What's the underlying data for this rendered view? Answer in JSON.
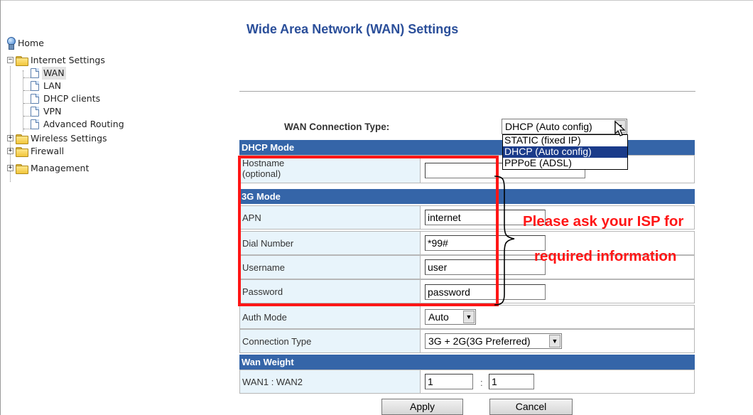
{
  "nav": {
    "items": [
      {
        "label": "Home"
      },
      {
        "label": "Internet Settings"
      },
      {
        "label": "WAN"
      },
      {
        "label": "LAN"
      },
      {
        "label": "DHCP clients"
      },
      {
        "label": "VPN"
      },
      {
        "label": "Advanced Routing"
      },
      {
        "label": "Wireless Settings"
      },
      {
        "label": "Firewall"
      },
      {
        "label": "Management"
      }
    ],
    "selected": "WAN"
  },
  "page": {
    "title": "Wide Area Network (WAN) Settings"
  },
  "wan_connection": {
    "label": "WAN Connection Type:",
    "selected": "DHCP (Auto config)",
    "options": [
      "STATIC (fixed IP)",
      "DHCP (Auto config)",
      "PPPoE (ADSL)"
    ],
    "highlighted": "DHCP (Auto config)"
  },
  "dhcp_mode": {
    "header": "DHCP Mode",
    "hostname_label_line1": "Hostname",
    "hostname_label_line2": "(optional)",
    "hostname_value": ""
  },
  "mode_3g": {
    "header": "3G Mode",
    "apn_label": "APN",
    "apn_value": "internet",
    "dial_label": "Dial Number",
    "dial_value": "*99#",
    "username_label": "Username",
    "username_value": "user",
    "password_label": "Password",
    "password_value": "password",
    "auth_label": "Auth Mode",
    "auth_value": "Auto",
    "conn_type_label": "Connection Type",
    "conn_type_value": "3G + 2G(3G Preferred)"
  },
  "wan_weight": {
    "header": "Wan Weight",
    "label": "WAN1 : WAN2",
    "wan1": "1",
    "separator": ":",
    "wan2": "1"
  },
  "buttons": {
    "apply": "Apply",
    "cancel": "Cancel"
  },
  "annotation": {
    "line1": "Please ask your ISP for",
    "line2": "required information",
    "color": "#ff1616"
  },
  "colors": {
    "section_header": "#3565a8",
    "label_cell": "#e8f4fb",
    "title": "#2b4f9a"
  }
}
